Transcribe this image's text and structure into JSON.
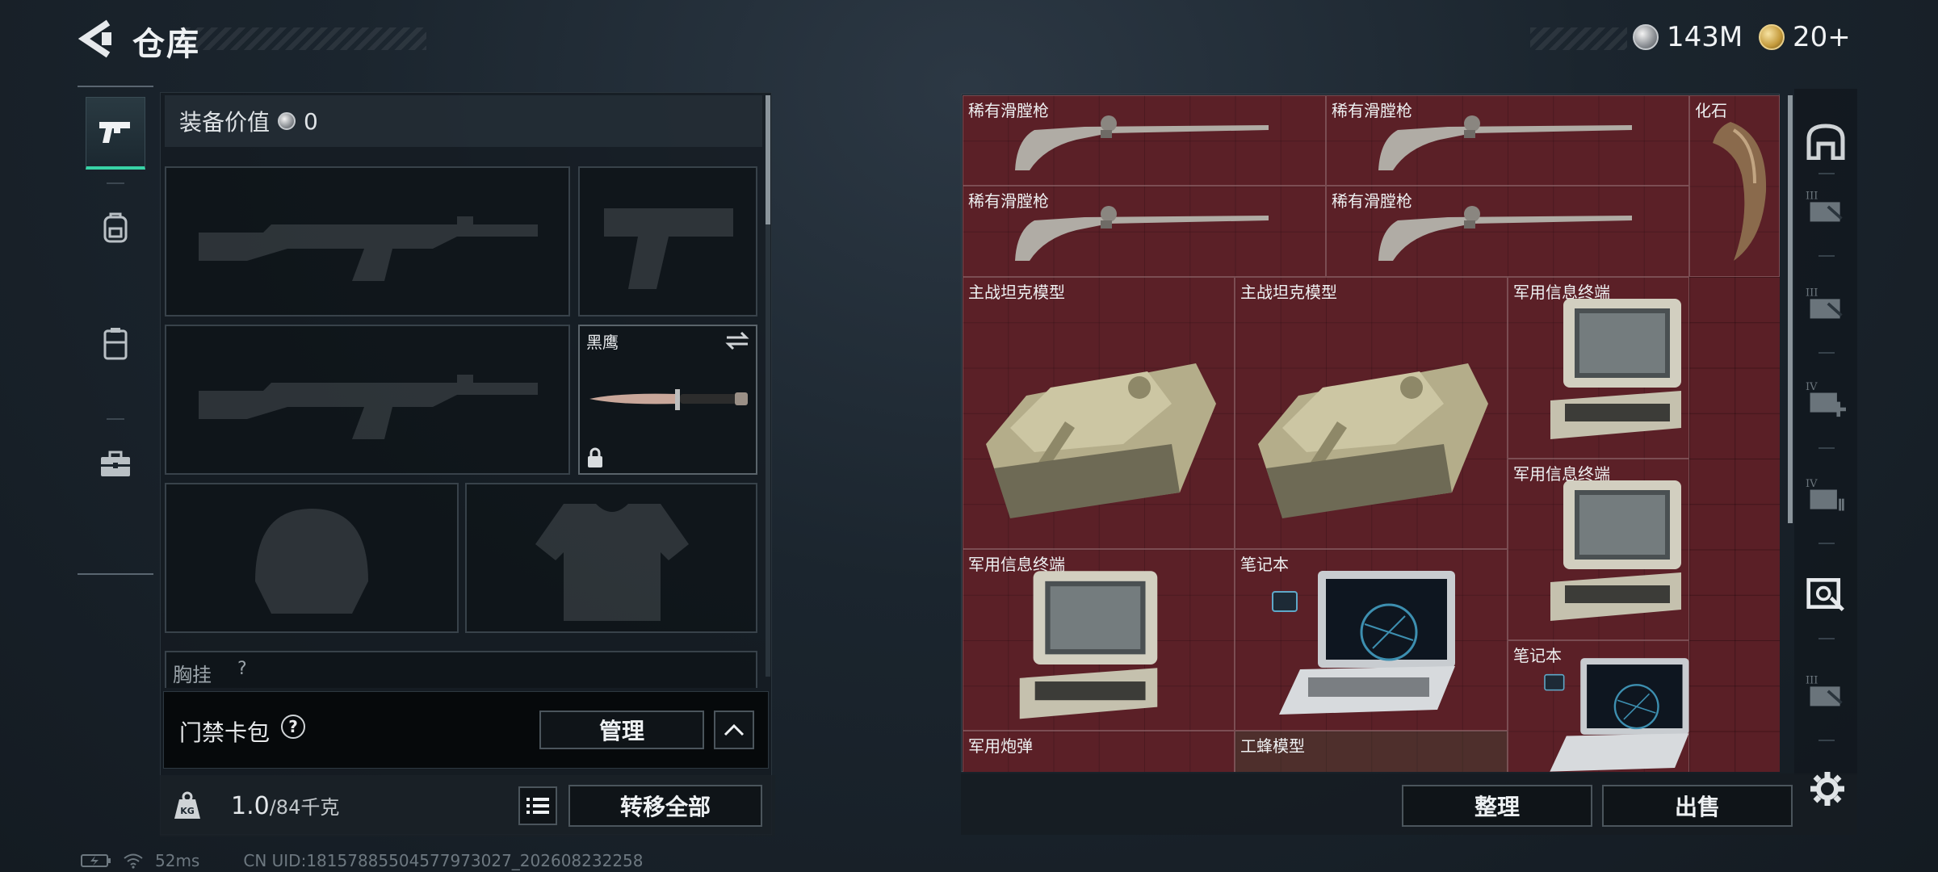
{
  "header": {
    "title": "仓库",
    "currencies": [
      {
        "icon": "silver-coin-icon",
        "value": "143M"
      },
      {
        "icon": "gold-coin-icon",
        "value": "20+"
      }
    ]
  },
  "sidebar": {
    "items": [
      {
        "icon": "pistol-icon",
        "active": true
      },
      {
        "icon": "backpack-icon",
        "active": false
      },
      {
        "icon": "chest-rig-icon",
        "active": false
      },
      {
        "icon": "toolbox-icon",
        "active": false
      }
    ]
  },
  "equipment": {
    "value_label": "装备价值",
    "value": "0",
    "knife_slot_name": "黑鹰",
    "chest_rig_label": "胸挂",
    "keycard_label": "门禁卡包",
    "manage_label": "管理",
    "capacity_value": "1.0",
    "capacity_unit": "/84千克",
    "transfer_all_label": "转移全部"
  },
  "stash": {
    "items": [
      {
        "name": "稀有滑膛枪",
        "kind": "musket"
      },
      {
        "name": "稀有滑膛枪",
        "kind": "musket"
      },
      {
        "name": "化石",
        "kind": "fossil"
      },
      {
        "name": "稀有滑膛枪",
        "kind": "musket"
      },
      {
        "name": "稀有滑膛枪",
        "kind": "musket"
      },
      {
        "name": "主战坦克模型",
        "kind": "tank"
      },
      {
        "name": "主战坦克模型",
        "kind": "tank"
      },
      {
        "name": "军用信息终端",
        "kind": "terminal"
      },
      {
        "name": "军用信息终端",
        "kind": "terminal"
      },
      {
        "name": "军用信息终端",
        "kind": "terminal"
      },
      {
        "name": "笔记本",
        "kind": "laptop"
      },
      {
        "name": "笔记本",
        "kind": "laptop"
      },
      {
        "name": "军用炮弹",
        "kind": "shell"
      },
      {
        "name": "工蜂模型",
        "kind": "drone"
      }
    ],
    "sort_label": "整理",
    "sell_label": "出售"
  },
  "categories": [
    {
      "icon": "all-items-icon"
    },
    {
      "icon": "tier-3-container-icon",
      "tier": "III"
    },
    {
      "icon": "tier-3-container-icon",
      "tier": "III"
    },
    {
      "icon": "tier-4-medical-icon",
      "tier": "IV"
    },
    {
      "icon": "tier-4-ammo-box-icon",
      "tier": "IV"
    },
    {
      "icon": "collectibles-icon",
      "active": true
    },
    {
      "icon": "tier-3-container-icon",
      "tier": "III"
    }
  ],
  "status_bar": {
    "ping": "52ms",
    "uid": "CN UID:18157885504577973027_202608232258"
  }
}
